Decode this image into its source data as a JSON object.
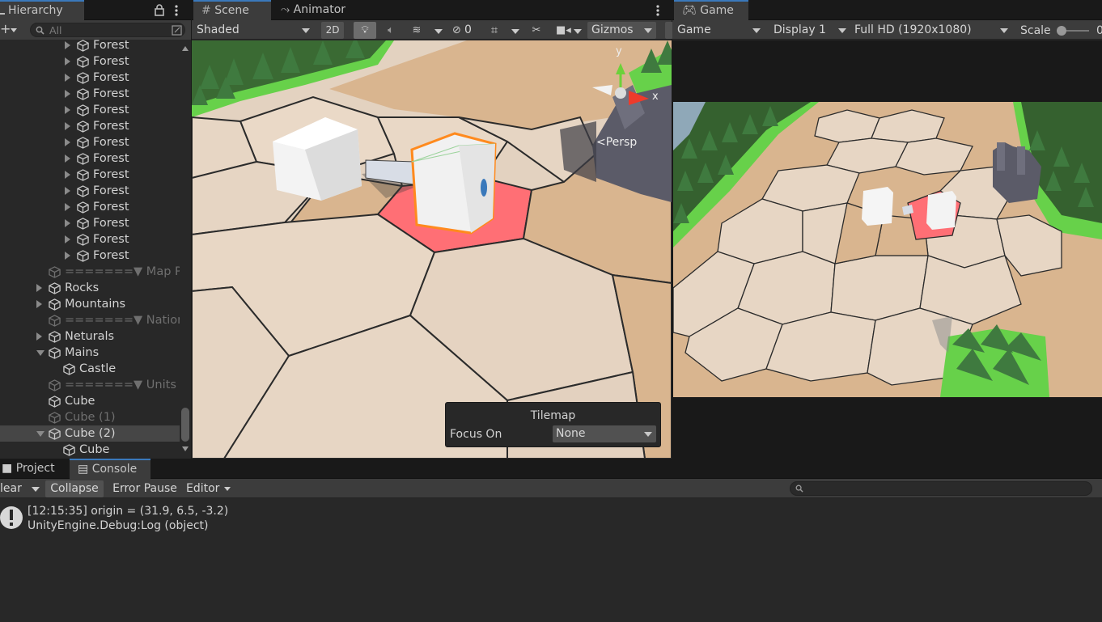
{
  "hierarchy": {
    "tab_label": "Hierarchy",
    "search_placeholder": "All",
    "items": [
      {
        "label": "Forest"
      },
      {
        "label": "Forest"
      },
      {
        "label": "Forest"
      },
      {
        "label": "Forest"
      },
      {
        "label": "Forest"
      },
      {
        "label": "Forest"
      },
      {
        "label": "Forest"
      },
      {
        "label": "Forest"
      },
      {
        "label": "Forest"
      },
      {
        "label": "Forest"
      },
      {
        "label": "Forest"
      },
      {
        "label": "Forest"
      },
      {
        "label": "Forest"
      },
      {
        "label": "Forest"
      },
      {
        "label": "=======▼ Map P"
      },
      {
        "label": "Rocks"
      },
      {
        "label": "Mountains"
      },
      {
        "label": "=======▼ Nation"
      },
      {
        "label": "Neturals"
      },
      {
        "label": "Mains"
      },
      {
        "label": "Castle"
      },
      {
        "label": "=======▼ Units "
      },
      {
        "label": "Cube"
      },
      {
        "label": "Cube (1)"
      },
      {
        "label": "Cube (2)"
      },
      {
        "label": "Cube"
      }
    ]
  },
  "scene": {
    "tab_scene": "Scene",
    "tab_animator": "Animator",
    "shading_mode": "Shaded",
    "btn_2d": "2D",
    "hidden_count": "0",
    "gizmos_label": "Gizmos",
    "persp_label": "Persp",
    "axis_y": "y",
    "axis_x": "x",
    "overlay": {
      "title": "Tilemap",
      "focus_label": "Focus On",
      "focus_value": "None"
    }
  },
  "game": {
    "tab_label": "Game",
    "mode": "Game",
    "display": "Display 1",
    "resolution": "Full HD (1920x1080)",
    "scale_label": "Scale",
    "scale_value": "0"
  },
  "bottom": {
    "tab_project": "Project",
    "tab_console": "Console",
    "clear_label": "lear",
    "collapse_label": "Collapse",
    "error_pause_label": "Error Pause",
    "editor_label": "Editor",
    "log": [
      {
        "line1": "[12:15:35] origin = (31.9, 6.5, -3.2)",
        "line2": "UnityEngine.Debug:Log (object)"
      }
    ]
  },
  "colors": {
    "accent": "#3a79bb",
    "selected_tile": "#ff6f75",
    "tile": "#e6d5c3",
    "tile_dark": "#d9b58f",
    "grass": "#67d14a",
    "tree": "#3f7a3f"
  }
}
